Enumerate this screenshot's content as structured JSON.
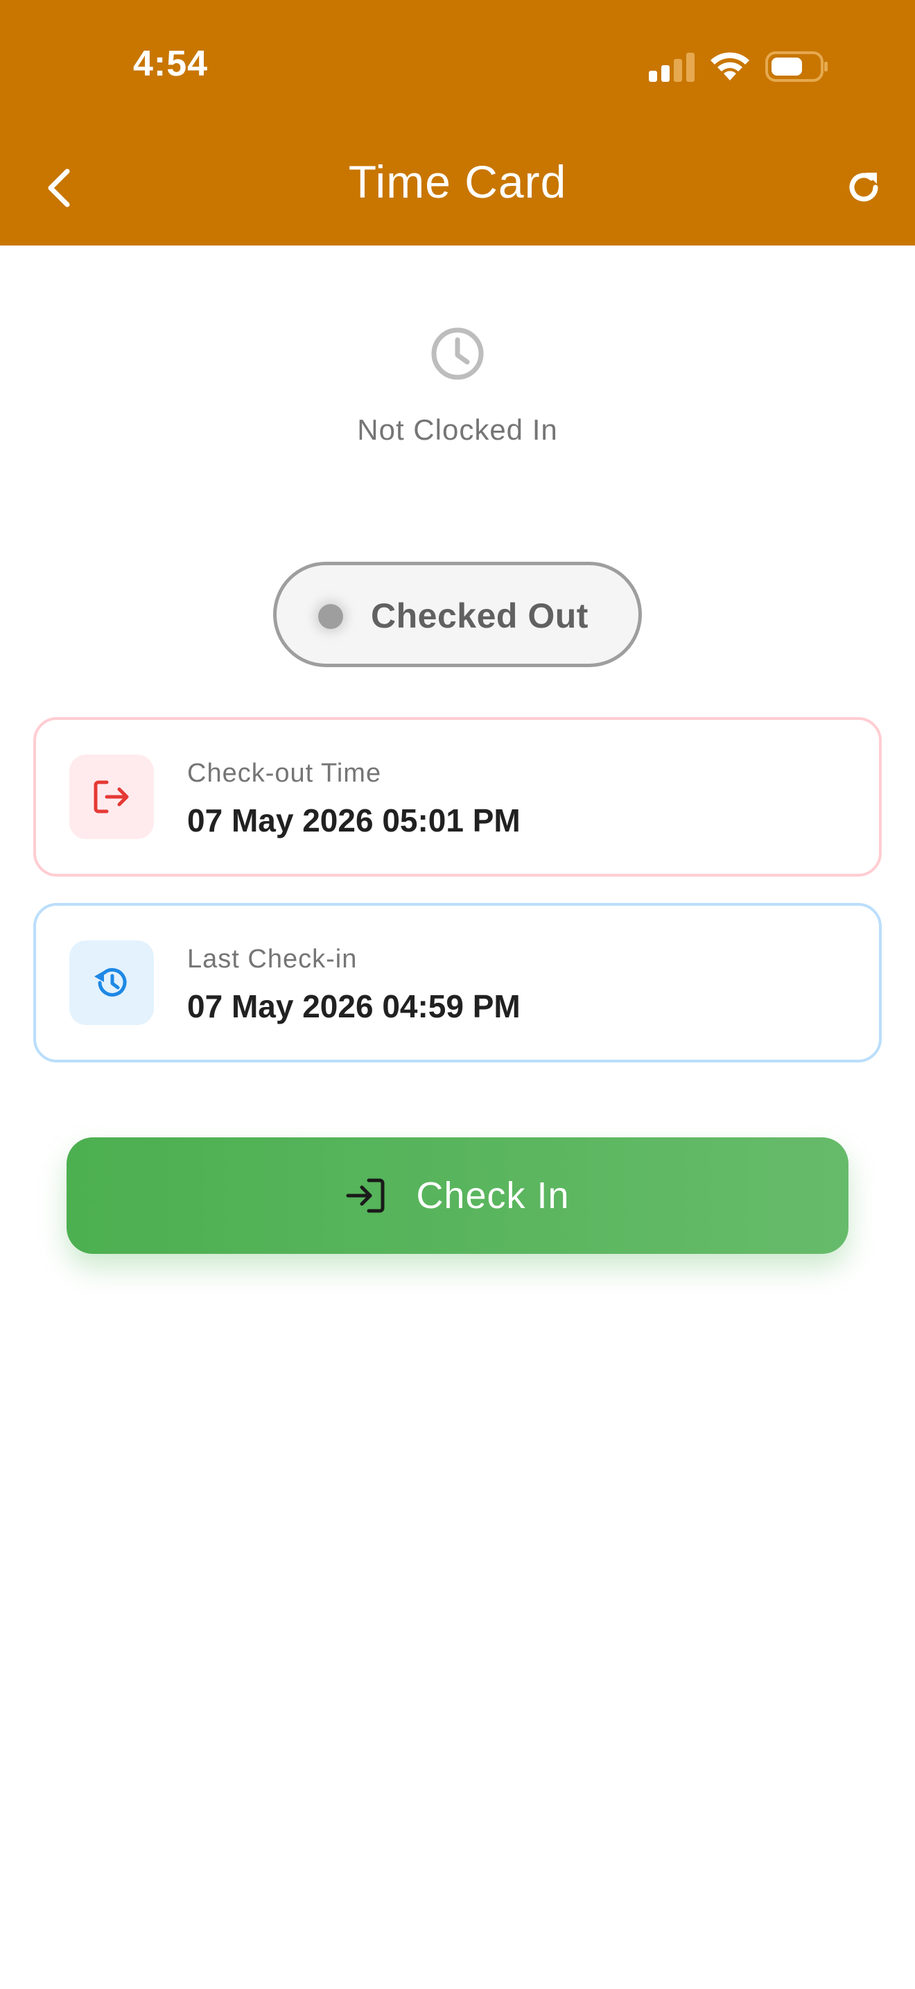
{
  "status_bar": {
    "time": "4:54"
  },
  "header": {
    "title": "Time Card",
    "background": "#c87600",
    "back_icon": "chevron-left-icon",
    "refresh_icon": "refresh-icon"
  },
  "clock_status": {
    "icon": "clock-icon",
    "text": "Not Clocked In"
  },
  "status_pill": {
    "label": "Checked Out"
  },
  "cards": {
    "checkout": {
      "icon": "logout-icon",
      "label": "Check-out Time",
      "value": "07 May 2026 05:01 PM",
      "accent": "#e53935"
    },
    "last_checkin": {
      "icon": "history-icon",
      "label": "Last Check-in",
      "value": "07 May 2026 04:59 PM",
      "accent": "#1e88e5"
    }
  },
  "primary_action": {
    "label": "Check In",
    "icon": "login-icon",
    "color": "#4caf50"
  }
}
